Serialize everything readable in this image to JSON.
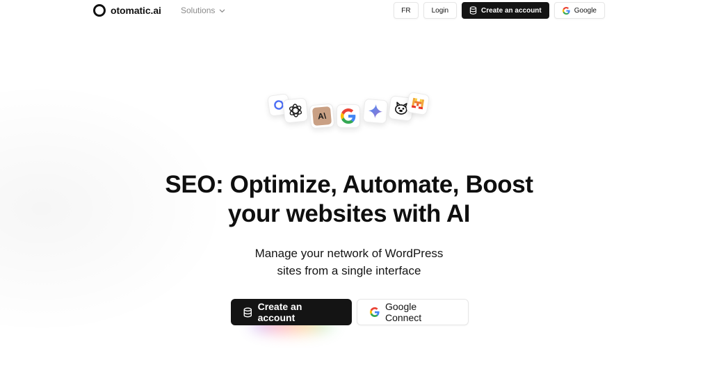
{
  "header": {
    "brand": "otomatic.ai",
    "solutions_label": "Solutions",
    "lang_label": "FR",
    "login_label": "Login",
    "create_account_label": "Create an account",
    "google_label": "Google"
  },
  "logos": [
    "openrouter-icon",
    "openai-icon",
    "anthropic-icon",
    "google-icon",
    "gemini-icon",
    "ollama-icon",
    "mistral-icon"
  ],
  "hero": {
    "title_line1": "SEO: Optimize, Automate, Boost",
    "title_line2": "your websites with AI",
    "subtitle_line1": "Manage your network of WordPress",
    "subtitle_line2": "sites from a single interface",
    "primary_cta": "Create an account",
    "secondary_cta": "Google Connect"
  },
  "colors": {
    "dark": "#141414",
    "border": "#e6e6e6",
    "muted": "#8a8a8a",
    "google_blue": "#4285F4",
    "google_red": "#EA4335",
    "google_yellow": "#FBBC05",
    "google_green": "#34A853"
  }
}
